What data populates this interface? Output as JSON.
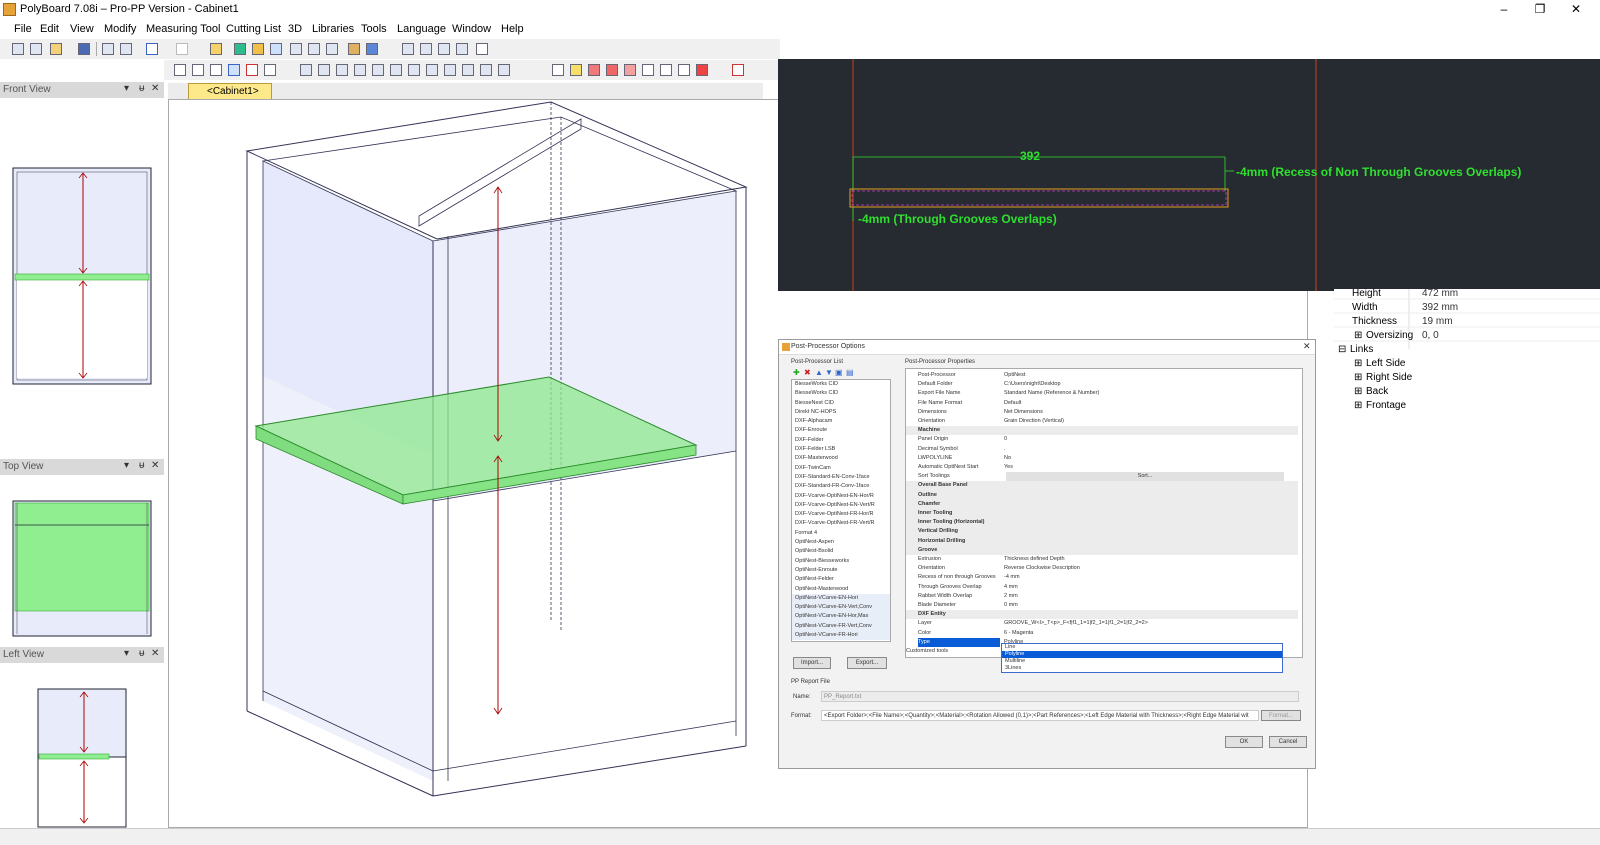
{
  "window": {
    "title": "PolyBoard 7.08i – Pro-PP Version - Cabinet1",
    "minimize": "–",
    "maximize": "❐",
    "close": "✕"
  },
  "menu": [
    "File",
    "Edit",
    "View",
    "Modify",
    "Measuring Tool",
    "Cutting List",
    "3D",
    "Libraries",
    "Tools",
    "Language",
    "Window",
    "Help"
  ],
  "panels": {
    "front": "Front View",
    "top": "Top View",
    "left": "Left View",
    "pin": "ᵾ",
    "close": "✕",
    "menu": "▾"
  },
  "tabs": {
    "cabinet": "<Cabinet1>"
  },
  "cad": {
    "width_dim": "392",
    "recess_label": "-4mm (Recess of Non Through Grooves Overlaps)",
    "overlap_label": "-4mm (Through Grooves Overlaps)"
  },
  "properties": {
    "height": {
      "label": "Height",
      "value": "472 mm"
    },
    "width": {
      "label": "Width",
      "value": "392 mm"
    },
    "thickness": {
      "label": "Thickness",
      "value": "19 mm"
    },
    "oversizing": {
      "label": "Oversizing",
      "value": "0, 0"
    },
    "links": "Links",
    "link_items": [
      "Left Side",
      "Right Side",
      "Back",
      "Frontage"
    ]
  },
  "dialog": {
    "title": "Post-Processor Options",
    "list_title": "Post-Processor List",
    "props_title": "Post-Processor Properties",
    "list": [
      "BiesseWorks CID",
      "BiesseWorks CID",
      "BiesseNest CID",
      "Direkt NC-HOPS",
      "DXF-Alphacam",
      "DXF-Enroute",
      "DXF-Felder",
      "DXF-Felder LSB",
      "DXF-Masterwood",
      "DXF-TwinCam",
      "DXF-Standard-EN-Conv-1face",
      "DXF-Standard-FR-Conv-1face",
      "DXF-Vcarve-OptiNest-EN-Hor/R",
      "DXF-Vcarve-OptiNest-EN-Vert/R",
      "DXF-Vcarve-OptiNest-FR-Hor/R",
      "DXF-Vcarve-OptiNest-FR-Vert/R",
      "Format 4",
      "OptiNest-Aspen",
      "OptiNest-Bsolid",
      "OptiNest-Biesseworks",
      "OptiNest-Enroute",
      "OptiNest-Felder",
      "OptiNest-Masterwood",
      "OptiNest-VCarve-EN-Hori",
      "OptiNest-VCarve-EN-Vert,Conv",
      "OptiNest-VCarve-EN-Hor,Max",
      "OptiNest-VCarve-FR-Vert,Conv",
      "OptiNest-VCarve-FR-Hori"
    ],
    "props": [
      {
        "k": "Post-Processor",
        "v": "OptiNest"
      },
      {
        "k": "Default Folder",
        "v": "C:\\Users\\night\\Desktop"
      },
      {
        "k": "Export File Name",
        "v": "Standard Name (Reference & Number)"
      },
      {
        "k": "File Name Format",
        "v": "Default"
      },
      {
        "k": "Dimensions",
        "v": "Net Dimensions"
      },
      {
        "k": "Orientation",
        "v": "Grain Direction (Vertical)"
      },
      {
        "k": "Machine",
        "v": "",
        "section": true
      },
      {
        "k": "Panel Origin",
        "v": "0"
      },
      {
        "k": "Decimal Symbol",
        "v": "."
      },
      {
        "k": "LWPOLYLINE",
        "v": "No"
      },
      {
        "k": "Automatic OptiNest Start",
        "v": "Yes"
      },
      {
        "k": "Sort Toolings",
        "v": "Sort..."
      },
      {
        "k": "Overall Base Panel",
        "v": "",
        "section": true
      },
      {
        "k": "Outline",
        "v": "",
        "section": true
      },
      {
        "k": "Chamfer",
        "v": "",
        "section": true
      },
      {
        "k": "Inner Tooling",
        "v": "",
        "section": true
      },
      {
        "k": "Inner Tooling (Horizontal)",
        "v": "",
        "section": true
      },
      {
        "k": "Vertical Drilling",
        "v": "",
        "section": true
      },
      {
        "k": "Horizontal Drilling",
        "v": "",
        "section": true
      },
      {
        "k": "Groove",
        "v": "",
        "section": true
      },
      {
        "k": "Extrusion",
        "v": "Thickness defined Depth"
      },
      {
        "k": "Orientation",
        "v": "Reverse Clockwise Description"
      },
      {
        "k": "Recess of non through Grooves",
        "v": "-4 mm"
      },
      {
        "k": "Through Grooves Overlap",
        "v": "4 mm"
      },
      {
        "k": "Rabbet Width Overlap",
        "v": "2 mm"
      },
      {
        "k": "Blade Diameter",
        "v": "0 mm"
      },
      {
        "k": "DXF Entity",
        "v": "",
        "section": true
      },
      {
        "k": "Layer",
        "v": "GROOVE_W<l>_T<p>_F<f|f1_1=1|f2_1=1|f1_2=1|f2_2=2>"
      },
      {
        "k": "Color",
        "v": "6 - Magenta"
      },
      {
        "k": "Type",
        "v": "Polyline",
        "selected": true
      }
    ],
    "customized_tools": "Customized tools",
    "dropdown": [
      "Line",
      "Polyline",
      "Multiline",
      "3Lines"
    ],
    "import": "Import...",
    "export": "Export...",
    "report_title": "PP Report File",
    "name_label": "Name:",
    "name_value": "PP_Report.txt",
    "format_label": "Format:",
    "format_value": "<Export Folder>;<File Name>;<Quantity>;<Material>;<Rotation Allowed (0,1)>;<Part References>;<Left Edge Material with Thickness>;<Right Edge Material wit",
    "format_btn": "Format...",
    "ok": "OK",
    "cancel": "Cancel"
  }
}
